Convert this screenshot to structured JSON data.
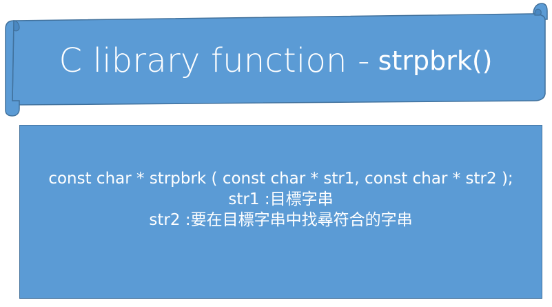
{
  "banner": {
    "title_main": "C library function -",
    "title_func": "strpbrk()"
  },
  "content": {
    "lines": [
      "const char * strpbrk ( const char * str1, const char * str2 );",
      "str1 :目標字串",
      "str2 :要在目標字串中找尋符合的字串"
    ]
  },
  "colors": {
    "fill": "#5b9bd5",
    "border": "#41719c",
    "text": "#ffffff"
  }
}
